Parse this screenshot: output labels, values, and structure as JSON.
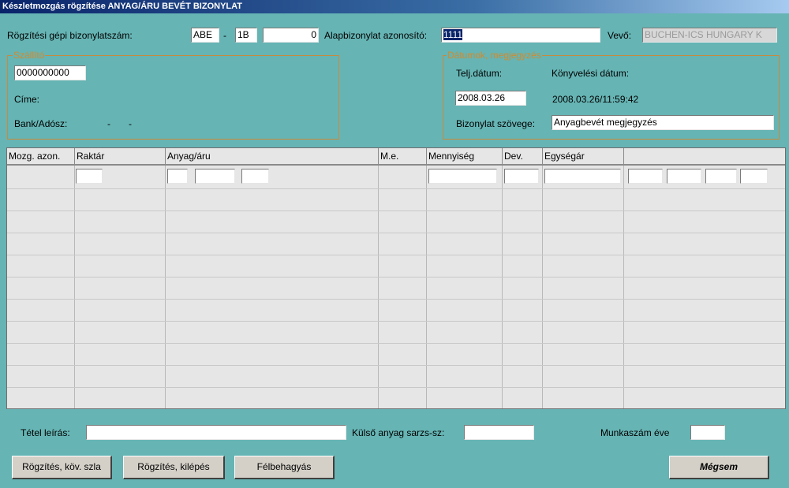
{
  "window": {
    "title": "Készletmozgás rögzítése ANYAG/ÁRU BEVÉT BIZONYLAT"
  },
  "header": {
    "doc_number_label": "Rögzítési gépi bizonylatszám:",
    "doc_prefix": "ABE",
    "dash": "-",
    "doc_series": "1B",
    "doc_number": "0",
    "base_doc_label": "Alapbizonylat azonosító:",
    "base_doc_value": "1111",
    "customer_label": "Vevő:",
    "customer_value": "BUCHEN-ICS HUNGARY K"
  },
  "supplier": {
    "title": "Szállító",
    "code": "0000000000",
    "address_label": "Címe:",
    "bank_label": "Bank/Adósz:",
    "bank_value": "-",
    "tax_value": "-"
  },
  "dates": {
    "title": "Dátumok, megjegyzés",
    "perf_date_label": "Telj.dátum:",
    "booking_date_label": "Könyvelési dátum:",
    "perf_date_value": "2008.03.26",
    "booking_date_value": "2008.03.26/11:59:42",
    "doc_text_label": "Bizonylat szövege:",
    "doc_text_value": "Anyagbevét megjegyzés"
  },
  "grid": {
    "columns": [
      {
        "label": "Mozg. azon."
      },
      {
        "label": "Raktár"
      },
      {
        "label": "Anyag/áru"
      },
      {
        "label": "M.e."
      },
      {
        "label": "Mennyiség"
      },
      {
        "label": "Dev."
      },
      {
        "label": "Egységár"
      },
      {
        "label": ""
      }
    ]
  },
  "footer": {
    "item_desc_label": "Tétel leírás:",
    "item_desc_value": "",
    "external_batch_label": "Külső anyag sarzs-sz:",
    "external_batch_value": "",
    "work_year_label": "Munkaszám éve",
    "work_year_value": ""
  },
  "buttons": {
    "save_next": "Rögzítés, köv. szla",
    "save_exit": "Rögzítés, kilépés",
    "suspend": "Félbehagyás",
    "cancel": "Mégsem"
  }
}
